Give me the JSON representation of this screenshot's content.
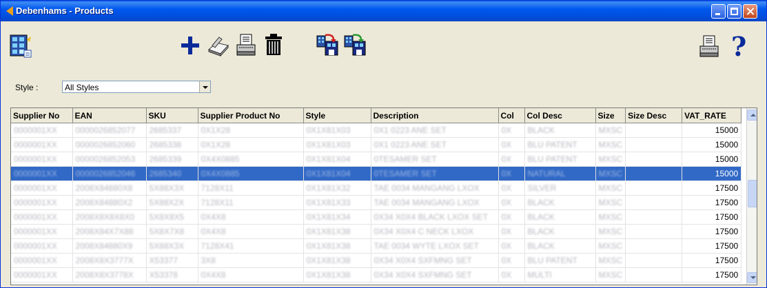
{
  "window": {
    "title": "Debenhams - Products"
  },
  "toolbar": {
    "left": [
      {
        "icon": "product-list-icon"
      }
    ],
    "center": [
      {
        "icon": "add-icon"
      },
      {
        "icon": "edit-book-icon"
      },
      {
        "icon": "print-icon"
      },
      {
        "icon": "delete-trash-icon"
      },
      {
        "icon": "import-icon"
      },
      {
        "icon": "export-icon"
      }
    ],
    "right": [
      {
        "icon": "printer-icon"
      },
      {
        "icon": "help-icon"
      }
    ]
  },
  "filter": {
    "label": "Style :",
    "value": "All Styles"
  },
  "table": {
    "columns": [
      "Supplier No",
      "EAN",
      "SKU",
      "Supplier Product No",
      "Style",
      "Description",
      "Col",
      "Col Desc",
      "Size",
      "Size Desc",
      "VAT_RATE"
    ],
    "selected_row": 3,
    "rows": [
      [
        "0000001XX",
        "0000026852077",
        "2685337",
        "0X1X28",
        "0X1X81X03",
        "0X1 0223 ANE SET",
        "0X",
        "BLACK",
        "MXSC",
        "",
        "15000"
      ],
      [
        "0000001XX",
        "0000026852060",
        "2685338",
        "0X1X28",
        "0X1X81X03",
        "0X1 0223 ANE SET",
        "0X",
        "BLU PATENT",
        "MXSC",
        "",
        "15000"
      ],
      [
        "0000001XX",
        "0000026852053",
        "2685339",
        "0X4X0885",
        "0X1X81X04",
        "0TESAMER SET",
        "0X",
        "BLU PATENT",
        "MXSC",
        "",
        "15000"
      ],
      [
        "0000001XX",
        "0000026852046",
        "2685340",
        "0X4X0885",
        "0X1X81X04",
        "0TESAMER SET",
        "0X",
        "NATURAL",
        "MXSC",
        "",
        "15000"
      ],
      [
        "0000001XX",
        "2008X84880X8",
        "5X88X3X",
        "7128X11",
        "0X1X81X32",
        "TAE 0034 MANGANG LXOX",
        "0X",
        "SILVER",
        "MXSC",
        "",
        "17500"
      ],
      [
        "0000001XX",
        "2008X84880X2",
        "5X88X2X",
        "7128X11",
        "0X1X81X33",
        "TAE 0034 MANGANG LXOX",
        "0X",
        "BLACK",
        "MXSC",
        "",
        "17500"
      ],
      [
        "0000001XX",
        "2008X8X8X8X0",
        "5X8X8X5",
        "0X4X8",
        "0X1X81X34",
        "0X34 X0X4 BLACK LXOX SET",
        "0X",
        "BLACK",
        "MXSC",
        "",
        "17500"
      ],
      [
        "0000001XX",
        "2008X84X7X88",
        "5X8X7X8",
        "0X4X8",
        "0X1X81X38",
        "0X34 X0X4 C NECK LXOX",
        "0X",
        "BLACK",
        "MXSC",
        "",
        "17500"
      ],
      [
        "0000001XX",
        "2008X84880X9",
        "5X88X3X",
        "7128X41",
        "0X1X81X38",
        "TAE 0034 WYTE LXOX SET",
        "0X",
        "BLACK",
        "MXSC",
        "",
        "17500"
      ],
      [
        "0000001XX",
        "2008X8X3777X",
        "X53377",
        "3X8",
        "0X1X81X38",
        "0X34 X0X4 SXFMNG SET",
        "0X",
        "BLU PATENT",
        "MXSC",
        "",
        "17500"
      ],
      [
        "0000001XX",
        "2008X8X3778X",
        "X53378",
        "0X4X8",
        "0X1X81X38",
        "0X34 X0X4 SXFMNG SET",
        "0X",
        "MULTI",
        "MXSC",
        "",
        "17500"
      ]
    ]
  }
}
